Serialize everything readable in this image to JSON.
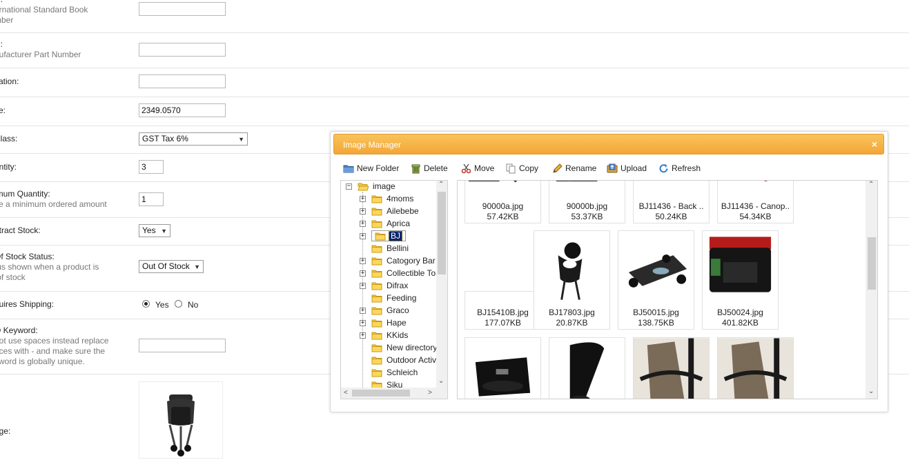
{
  "form": {
    "isbn": {
      "title": "N:",
      "help": "ernational Standard Book\nmber"
    },
    "mpn": {
      "title": "N:",
      "help": "nufacturer Part Number"
    },
    "location": {
      "title": "cation:"
    },
    "price": {
      "title": "ce:",
      "value": "2349.0570"
    },
    "tax_class": {
      "title": "Class:",
      "value": "GST Tax 6%"
    },
    "quantity": {
      "title": "antity:",
      "value": "3"
    },
    "minimum": {
      "title": "imum Quantity:",
      "help": "ce a minimum ordered amount",
      "value": "1"
    },
    "subtract": {
      "title": "otract Stock:",
      "value": "Yes"
    },
    "stock_status": {
      "title": "Of Stock Status:",
      "help": "tus shown when a product is\n of stock",
      "value": "Out Of Stock"
    },
    "shipping": {
      "title": "quires Shipping:",
      "yes": "Yes",
      "no": "No"
    },
    "seo": {
      "title": "O Keyword:",
      "help": "not use spaces instead replace\naces with - and make sure the\nyword is globally unique."
    },
    "image": {
      "title": "age:"
    }
  },
  "dialog": {
    "title": "Image Manager",
    "close": "×",
    "toolbar": {
      "new_folder": "New Folder",
      "delete": "Delete",
      "move": "Move",
      "copy": "Copy",
      "rename": "Rename",
      "upload": "Upload",
      "refresh": "Refresh"
    },
    "tree": {
      "root": "image",
      "folders": [
        "4moms",
        "Ailebebe",
        "Aprica",
        "BJ",
        "Bellini",
        "Catogory Bar",
        "Collectible To",
        "Difrax",
        "Feeding",
        "Graco",
        "Hape",
        "KKids",
        "New directory",
        "Outdoor Activ",
        "Schleich",
        "Siku"
      ],
      "selected": "BJ"
    },
    "files": [
      {
        "name": "90000a.jpg",
        "size": "57.42KB"
      },
      {
        "name": "90000b.jpg",
        "size": "53.37KB"
      },
      {
        "name": "BJ11436 - Back ..",
        "size": "50.24KB"
      },
      {
        "name": "BJ11436 - Canop..",
        "size": "54.34KB"
      },
      {
        "name": "BJ15410B.jpg",
        "size": "177.07KB"
      },
      {
        "name": "BJ17803.jpg",
        "size": "20.87KB"
      },
      {
        "name": "BJ50015.jpg",
        "size": "138.75KB"
      },
      {
        "name": "BJ50024.jpg",
        "size": "401.82KB"
      },
      {
        "name": "",
        "size": ""
      },
      {
        "name": "",
        "size": ""
      },
      {
        "name": "",
        "size": ""
      },
      {
        "name": "",
        "size": ""
      }
    ]
  }
}
